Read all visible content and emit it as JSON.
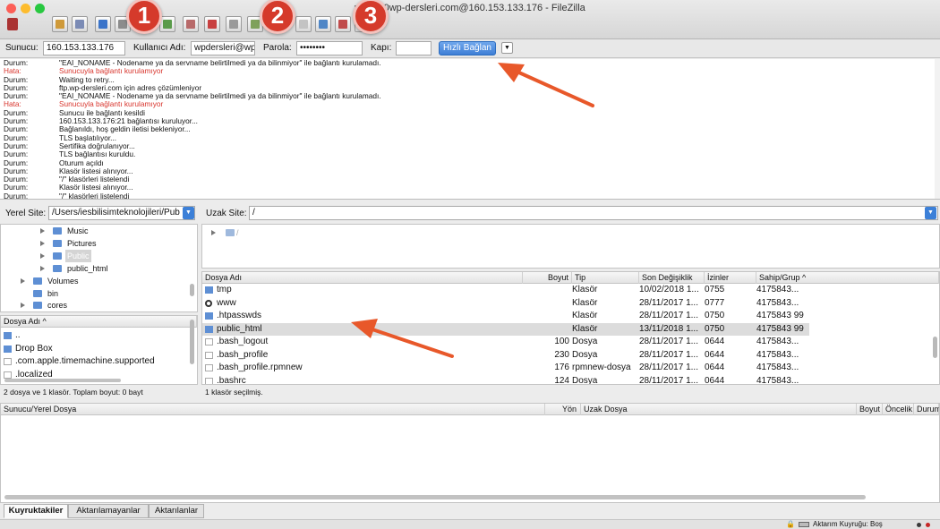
{
  "window": {
    "title": "w...%40wp-dersleri.com@160.153.133.176 - FileZilla"
  },
  "colors": {
    "error": "#d8342c",
    "accent": "#3f7fd6",
    "badge": "#d53a2b",
    "arrow": "#e8582a",
    "folder": "#5e8fd4"
  },
  "quickconnect": {
    "host_label": "Sunucu:",
    "host_value": "160.153.133.176",
    "user_label": "Kullanıcı Adı:",
    "user_value": "wpdersleri@wp",
    "pass_label": "Parola:",
    "pass_value": "••••••••",
    "port_label": "Kapı:",
    "port_value": "",
    "button_label": "Hızlı Bağlan",
    "dropdown_icon": "chevron-down-icon"
  },
  "annotations": {
    "badges": [
      "1",
      "2",
      "3"
    ]
  },
  "log": [
    {
      "k": "Durum:",
      "m": "\"EAI_NONAME - Nodename ya da servname belirtilmedi ya da bilinmiyor\" ile bağlantı kurulamadı.",
      "e": false
    },
    {
      "k": "Hata:",
      "m": "Sunucuyla bağlantı kurulamıyor",
      "e": true
    },
    {
      "k": "Durum:",
      "m": "Waiting to retry...",
      "e": false
    },
    {
      "k": "Durum:",
      "m": "ftp.wp-dersleri.com için adres çözümleniyor",
      "e": false
    },
    {
      "k": "Durum:",
      "m": "\"EAI_NONAME - Nodename ya da servname belirtilmedi ya da bilinmiyor\" ile bağlantı kurulamadı.",
      "e": false
    },
    {
      "k": "Hata:",
      "m": "Sunucuyla bağlantı kurulamıyor",
      "e": true
    },
    {
      "k": "Durum:",
      "m": "Sunucu ile bağlantı kesildi",
      "e": false
    },
    {
      "k": "Durum:",
      "m": "160.153.133.176:21 bağlantısı kuruluyor...",
      "e": false
    },
    {
      "k": "Durum:",
      "m": "Bağlanıldı, hoş geldin iletisi bekleniyor...",
      "e": false
    },
    {
      "k": "Durum:",
      "m": "TLS başlatılıyor...",
      "e": false
    },
    {
      "k": "Durum:",
      "m": "Sertifika doğrulanıyor...",
      "e": false
    },
    {
      "k": "Durum:",
      "m": "TLS bağlantısı kuruldu.",
      "e": false
    },
    {
      "k": "Durum:",
      "m": "Oturum açıldı",
      "e": false
    },
    {
      "k": "Durum:",
      "m": "Klasör listesi alınıyor...",
      "e": false
    },
    {
      "k": "Durum:",
      "m": "\"/\" klasörleri listelendi",
      "e": false
    },
    {
      "k": "Durum:",
      "m": "Klasör listesi alınıyor...",
      "e": false
    },
    {
      "k": "Durum:",
      "m": "\"/\" klasörleri listelendi",
      "e": false
    }
  ],
  "local": {
    "site_label": "Yerel Site:",
    "site_value": "/Users/iesbilisimteknolojileri/Pub",
    "tree": [
      {
        "name": "Music",
        "indent": 2,
        "expander": true,
        "selected": false
      },
      {
        "name": "Pictures",
        "indent": 2,
        "expander": true,
        "selected": false
      },
      {
        "name": "Public",
        "indent": 2,
        "expander": true,
        "selected": true
      },
      {
        "name": "public_html",
        "indent": 2,
        "expander": true,
        "selected": false
      },
      {
        "name": "Volumes",
        "indent": 1,
        "expander": true,
        "selected": false
      },
      {
        "name": "bin",
        "indent": 1,
        "expander": false,
        "selected": false
      },
      {
        "name": "cores",
        "indent": 1,
        "expander": true,
        "selected": false
      }
    ],
    "header": {
      "name": "Dosya Adı"
    },
    "files": [
      {
        "name": "..",
        "type": "folder"
      },
      {
        "name": "Drop Box",
        "type": "folder"
      },
      {
        "name": ".com.apple.timemachine.supported",
        "type": "file"
      },
      {
        "name": ".localized",
        "type": "file"
      }
    ],
    "status": "2 dosya ve 1 klasör. Toplam boyut: 0 bayt"
  },
  "remote": {
    "site_label": "Uzak Site:",
    "site_value": "/",
    "tree": [
      {
        "name": "/"
      }
    ],
    "headers": {
      "name": "Dosya Adı",
      "size": "Boyut",
      "type": "Tip",
      "modified": "Son Değişiklik",
      "perms": "İzinler",
      "owner": "Sahip/Grup"
    },
    "files": [
      {
        "name": "tmp",
        "size": "",
        "type": "Klasör",
        "modified": "10/02/2018 1...",
        "perms": "0755",
        "owner": "4175843...",
        "kind": "folder",
        "selected": false
      },
      {
        "name": "www",
        "size": "",
        "type": "Klasör",
        "modified": "28/11/2017 1...",
        "perms": "0777",
        "owner": "4175843...",
        "kind": "link",
        "selected": false
      },
      {
        "name": ".htpasswds",
        "size": "",
        "type": "Klasör",
        "modified": "28/11/2017 1...",
        "perms": "0750",
        "owner": "4175843 99",
        "kind": "folder",
        "selected": false
      },
      {
        "name": "public_html",
        "size": "",
        "type": "Klasör",
        "modified": "13/11/2018 1...",
        "perms": "0750",
        "owner": "4175843 99",
        "kind": "folder",
        "selected": true
      },
      {
        "name": ".bash_logout",
        "size": "100",
        "type": "Dosya",
        "modified": "28/11/2017 1...",
        "perms": "0644",
        "owner": "4175843...",
        "kind": "file",
        "selected": false
      },
      {
        "name": ".bash_profile",
        "size": "230",
        "type": "Dosya",
        "modified": "28/11/2017 1...",
        "perms": "0644",
        "owner": "4175843...",
        "kind": "file",
        "selected": false
      },
      {
        "name": ".bash_profile.rpmnew",
        "size": "176",
        "type": "rpmnew-dosya",
        "modified": "28/11/2017 1...",
        "perms": "0644",
        "owner": "4175843...",
        "kind": "file",
        "selected": false
      },
      {
        "name": ".bashrc",
        "size": "124",
        "type": "Dosya",
        "modified": "28/11/2017 1...",
        "perms": "0644",
        "owner": "4175843...",
        "kind": "file",
        "selected": false
      }
    ],
    "status": "1 klasör seçilmiş."
  },
  "queue": {
    "headers": {
      "local": "Sunucu/Yerel Dosya",
      "dir": "Yön",
      "remote": "Uzak Dosya",
      "size": "Boyut",
      "priority": "Öncelik",
      "state": "Durum"
    }
  },
  "tabs": [
    {
      "label": "Kuyruktakiler",
      "active": true
    },
    {
      "label": "Aktarılamayanlar",
      "active": false
    },
    {
      "label": "Aktarılanlar",
      "active": false
    }
  ],
  "statusbar": {
    "queue": "Aktarım Kuyruğu: Boş"
  }
}
